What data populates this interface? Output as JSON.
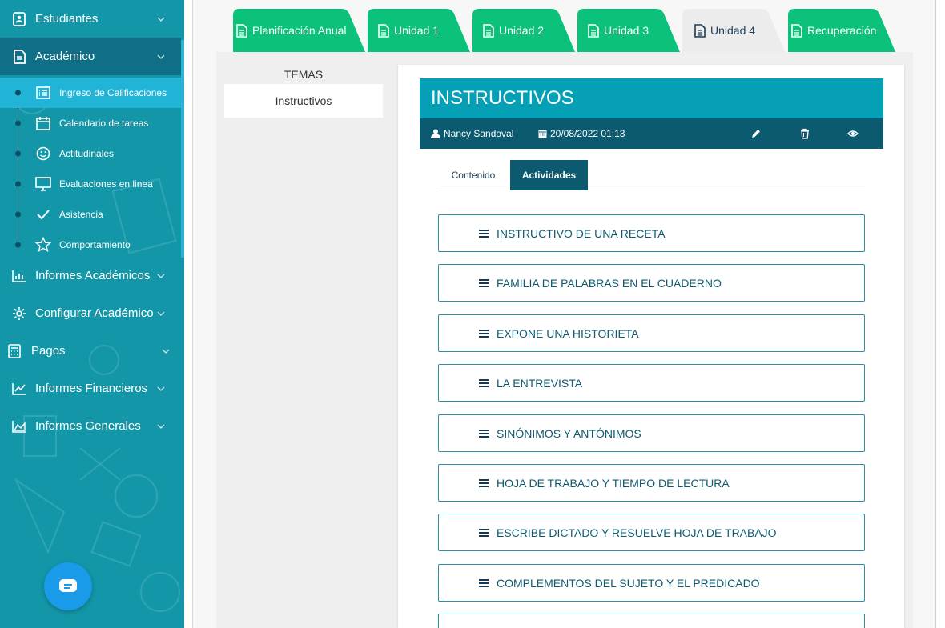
{
  "sidebar": {
    "items": [
      {
        "label": "Estudiantes",
        "icon": "student-icon"
      },
      {
        "label": "Académico",
        "icon": "document-icon"
      },
      {
        "label": "Informes Académicos",
        "icon": "bar-chart-icon"
      },
      {
        "label": "Configurar Académico",
        "icon": "gear-icon"
      },
      {
        "label": "Pagos",
        "icon": "calculator-icon"
      },
      {
        "label": "Informes Financieros",
        "icon": "line-chart-icon"
      },
      {
        "label": "Informes Generales",
        "icon": "area-chart-icon"
      }
    ],
    "sub_items": [
      {
        "label": "Ingreso de Calificaciones",
        "icon": "list-icon"
      },
      {
        "label": "Calendario de tareas",
        "icon": "calendar-icon"
      },
      {
        "label": "Actitudinales",
        "icon": "smile-icon"
      },
      {
        "label": "Evaluaciones en linea",
        "icon": "monitor-icon"
      },
      {
        "label": "Asistencia",
        "icon": "check-icon"
      },
      {
        "label": "Comportamiento",
        "icon": "star-icon"
      }
    ]
  },
  "tabs": [
    {
      "label": "Planificación Anual"
    },
    {
      "label": "Unidad 1"
    },
    {
      "label": "Unidad 2"
    },
    {
      "label": "Unidad 3"
    },
    {
      "label": "Unidad 4"
    },
    {
      "label": "Recuperación"
    }
  ],
  "temas": {
    "title": "TEMAS",
    "items": [
      "Instructivos"
    ]
  },
  "card": {
    "title": "INSTRUCTIVOS",
    "author": "Nancy Sandoval",
    "date": "20/08/2022 01:13"
  },
  "sub_tabs": {
    "content": "Contenido",
    "activities": "Actividades"
  },
  "activities": [
    "INSTRUCTIVO DE UNA RECETA",
    "FAMILIA DE PALABRAS EN EL CUADERNO",
    "EXPONE UNA HISTORIETA",
    "LA ENTREVISTA",
    "SINÓNIMOS Y ANTÓNIMOS",
    "HOJA DE TRABAJO Y TIEMPO DE LECTURA",
    "ESCRIBE DICTADO Y RESUELVE HOJA DE TRABAJO",
    "COMPLEMENTOS DEL SUJETO Y EL PREDICADO"
  ],
  "colors": {
    "sidebar": "#1397a8",
    "active": "#0f6f86",
    "tab_green": "#0cc27b",
    "header": "#05a0b5",
    "meta": "#0b5a70"
  }
}
